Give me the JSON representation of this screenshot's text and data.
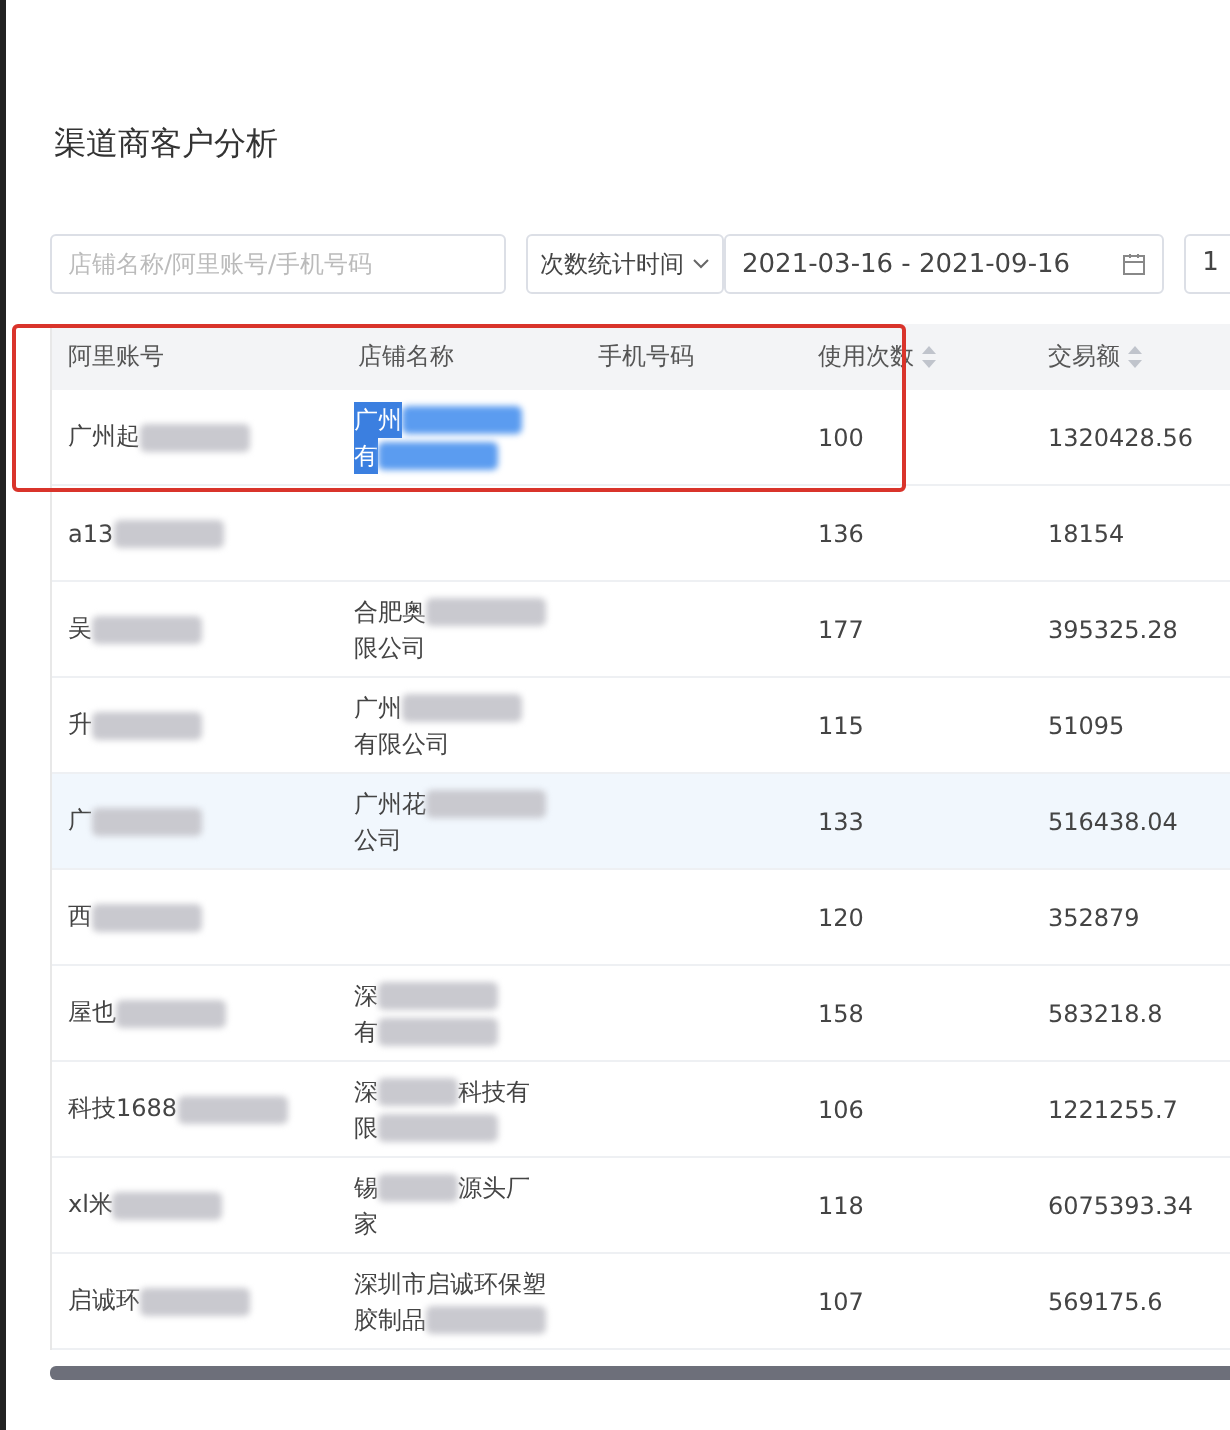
{
  "title": "渠道商客户分析",
  "filters": {
    "search": {
      "placeholder": "店铺名称/阿里账号/手机号码"
    },
    "stat_select": {
      "value": "次数统计时间"
    },
    "date_range": {
      "value": "2021-03-16 - 2021-09-16"
    },
    "extra_field": {
      "value": "1"
    }
  },
  "table": {
    "columns": [
      {
        "label": "阿里账号",
        "sortable": false
      },
      {
        "label": "店铺名称",
        "sortable": false
      },
      {
        "label": "手机号码",
        "sortable": false
      },
      {
        "label": "使用次数",
        "sortable": true
      },
      {
        "label": "交易额",
        "sortable": true
      }
    ],
    "rows": [
      {
        "account": {
          "text": "广州起",
          "redacted": true
        },
        "shop": {
          "selected": true,
          "lines": [
            {
              "parts": [
                "广州"
              ],
              "redacted": true
            },
            {
              "parts": [
                "有"
              ],
              "redacted": true
            }
          ]
        },
        "count": "100",
        "amount": "1320428.56",
        "hovered": false,
        "annotated": true
      },
      {
        "account": {
          "text": "a13",
          "redacted": true
        },
        "count": "136",
        "amount": "18154",
        "hovered": false,
        "annotated": false
      },
      {
        "account": {
          "text": "吴",
          "redacted": true
        },
        "shop": {
          "selected": false,
          "lines": [
            {
              "parts": [
                "合肥奥"
              ],
              "redacted": true
            },
            {
              "parts": [
                "限公司"
              ],
              "redacted": false
            }
          ]
        },
        "count": "177",
        "amount": "395325.28",
        "hovered": false,
        "annotated": false
      },
      {
        "account": {
          "text": "升",
          "redacted": true
        },
        "shop": {
          "selected": false,
          "lines": [
            {
              "parts": [
                "广州"
              ],
              "redacted": true
            },
            {
              "parts": [
                "有限公司"
              ],
              "redacted": false
            }
          ]
        },
        "count": "115",
        "amount": "51095",
        "hovered": false,
        "annotated": false
      },
      {
        "account": {
          "text": "广",
          "redacted": true
        },
        "shop": {
          "selected": false,
          "lines": [
            {
              "parts": [
                "广州花"
              ],
              "redacted": true
            },
            {
              "parts": [
                "公司"
              ],
              "redacted": false
            }
          ]
        },
        "count": "133",
        "amount": "516438.04",
        "hovered": true,
        "annotated": false
      },
      {
        "account": {
          "text": "西",
          "redacted": true
        },
        "count": "120",
        "amount": "352879",
        "hovered": false,
        "annotated": false
      },
      {
        "account": {
          "text": "屋也",
          "redacted": true
        },
        "shop": {
          "selected": false,
          "lines": [
            {
              "parts": [
                "深"
              ],
              "redacted": true
            },
            {
              "parts": [
                "有"
              ],
              "redacted": true
            }
          ]
        },
        "count": "158",
        "amount": "583218.8",
        "hovered": false,
        "annotated": false
      },
      {
        "account": {
          "text": "科技1688",
          "redacted": true
        },
        "shop": {
          "selected": false,
          "lines": [
            {
              "parts": [
                "深",
                "科技有"
              ],
              "redacted": true
            },
            {
              "parts": [
                "限"
              ],
              "redacted": true
            }
          ]
        },
        "count": "106",
        "amount": "1221255.7",
        "hovered": false,
        "annotated": false
      },
      {
        "account": {
          "text": "xl米",
          "redacted": true
        },
        "shop": {
          "selected": false,
          "lines": [
            {
              "parts": [
                "锡",
                "源头厂"
              ],
              "redacted": true
            },
            {
              "parts": [
                "家"
              ],
              "redacted": false
            }
          ]
        },
        "count": "118",
        "amount": "6075393.34",
        "hovered": false,
        "annotated": false
      },
      {
        "account": {
          "text": "启诚环",
          "redacted": true
        },
        "shop": {
          "selected": false,
          "lines": [
            {
              "parts": [
                "深圳市启诚环保塑"
              ],
              "redacted": false
            },
            {
              "parts": [
                "胶制品"
              ],
              "redacted": true
            }
          ]
        },
        "count": "107",
        "amount": "569175.6",
        "hovered": false,
        "annotated": false
      }
    ]
  }
}
